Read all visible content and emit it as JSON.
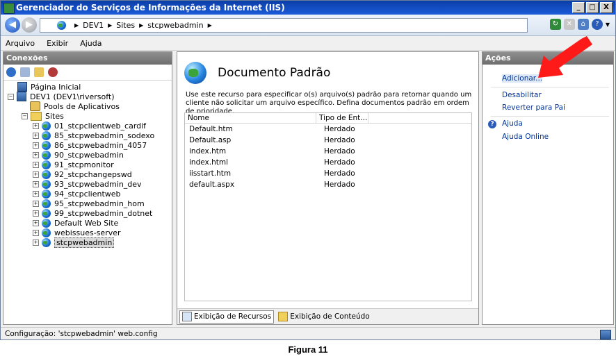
{
  "window": {
    "title": "Gerenciador do Serviços de Informações da Internet (IIS)"
  },
  "window_buttons": [
    "_",
    "□",
    "X"
  ],
  "navigation": {
    "breadcrumb": [
      "DEV1",
      "Sites",
      "stcpwebadmin"
    ]
  },
  "menu": [
    "Arquivo",
    "Exibir",
    "Ajuda"
  ],
  "connections": {
    "header": "Conexões",
    "tree": {
      "start_page": "Página Inicial",
      "server": "DEV1 (DEV1\\riversoft)",
      "app_pools": "Pools de Aplicativos",
      "sites_label": "Sites",
      "sites": [
        "01_stcpclientweb_cardif",
        "85_stcpwebadmin_sodexo",
        "86_stcpwebadmin_4057",
        "90_stcpwebadmin",
        "91_stcpmonitor",
        "92_stcpchangepswd",
        "93_stcpwebadmin_dev",
        "94_stcpclientweb",
        "95_stcpwebadmin_hom",
        "99_stcpwebadmin_dotnet",
        "Default Web Site",
        "webissues-server",
        "stcpwebadmin"
      ]
    }
  },
  "feature": {
    "title": "Documento Padrão",
    "description": "Use este recurso para especificar o(s) arquivo(s) padrão para retornar quando um cliente não solicitar um arquivo específico. Defina documentos padrão em ordem de prioridade.",
    "columns": [
      "Nome",
      "Tipo de Ent..."
    ],
    "rows": [
      [
        "Default.htm",
        "Herdado"
      ],
      [
        "Default.asp",
        "Herdado"
      ],
      [
        "index.htm",
        "Herdado"
      ],
      [
        "index.html",
        "Herdado"
      ],
      [
        "iisstart.htm",
        "Herdado"
      ],
      [
        "default.aspx",
        "Herdado"
      ]
    ],
    "tabs": [
      "Exibição de Recursos",
      "Exibição de Conteúdo"
    ]
  },
  "actions": {
    "header": "Ações",
    "items": [
      "Adicionar...",
      "Desabilitar",
      "Reverter para Pai"
    ],
    "help": [
      "Ajuda",
      "Ajuda Online"
    ]
  },
  "status": {
    "text": "Configuração: 'stcpwebadmin' web.config"
  },
  "caption": "Figura 11",
  "colors": {
    "title_bar": "#1c5ad8",
    "panel_header": "#6e6e6e",
    "link": "#003399",
    "arrow": "#ff1a1a"
  }
}
